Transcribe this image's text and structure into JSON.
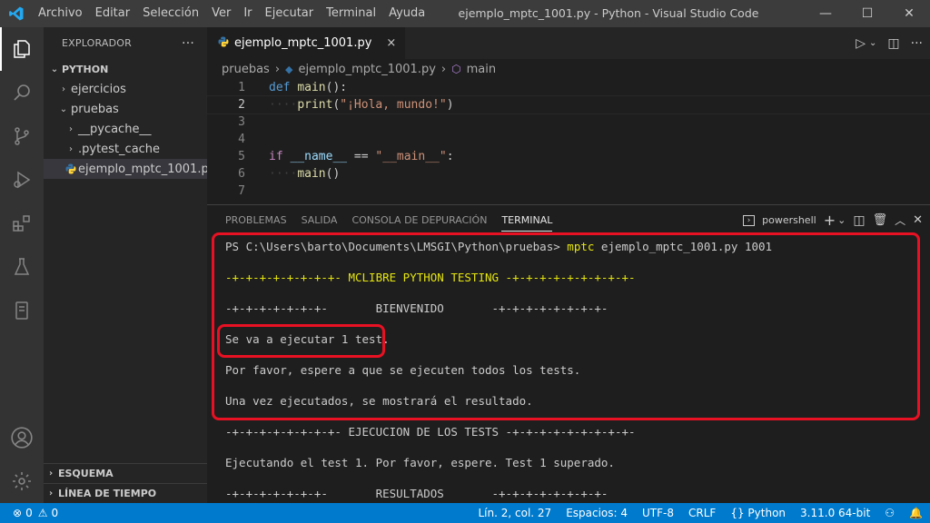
{
  "titlebar": {
    "menu": [
      "Archivo",
      "Editar",
      "Selección",
      "Ver",
      "Ir",
      "Ejecutar",
      "Terminal",
      "Ayuda"
    ],
    "window_title": "ejemplo_mptc_1001.py - Python - Visual Studio Code",
    "controls": {
      "minimize": "—",
      "maximize": "☐",
      "close": "✕"
    }
  },
  "activitybar": {
    "icons": [
      "explorer-icon",
      "search-icon",
      "source-control-icon",
      "run-debug-icon",
      "extensions-icon",
      "testing-icon",
      "remote-icon",
      "account-icon",
      "settings-gear-icon"
    ]
  },
  "sidebar": {
    "header": "EXPLORADOR",
    "more": "···",
    "root": "PYTHON",
    "items": [
      {
        "label": "ejercicios",
        "chev": "›"
      },
      {
        "label": "pruebas",
        "chev": "⌄"
      },
      {
        "label": "__pycache__",
        "chev": "›"
      },
      {
        "label": ".pytest_cache",
        "chev": "›"
      },
      {
        "label": "ejemplo_mptc_1001.py",
        "chev": ""
      }
    ],
    "outline": "ESQUEMA",
    "timeline": "LÍNEA DE TIEMPO"
  },
  "editor": {
    "tab_label": "ejemplo_mptc_1001.py",
    "tab_close": "×",
    "breadcrumb": [
      "pruebas",
      "ejemplo_mptc_1001.py",
      "main"
    ],
    "line_numbers": [
      "1",
      "2",
      "3",
      "4",
      "5",
      "6",
      "7"
    ],
    "code": {
      "l1_kw": "def",
      "l1_fn": "main",
      "l1_rest": "():",
      "l2_fn": "print",
      "l2_str": "\"¡Hola, mundo!\"",
      "l5_kw": "if",
      "l5_var": "__name__",
      "l5_op": " == ",
      "l5_str": "\"__main__\"",
      "l6_fn": "main"
    }
  },
  "panel": {
    "tabs": [
      "PROBLEMAS",
      "SALIDA",
      "CONSOLA DE DEPURACIÓN",
      "TERMINAL"
    ],
    "shell": "powershell",
    "terminal": {
      "prompt": "PS C:\\Users\\barto\\Documents\\LMSGI\\Python\\pruebas> ",
      "command": "mptc",
      "args": " ejemplo_mptc_1001.py 1001",
      "header": "-+-+-+-+-+-+-+-+- MCLIBRE PYTHON TESTING -+-+-+-+-+-+-+-+-+-",
      "welcome": "-+-+-+-+-+-+-+-       BIENVENIDO       -+-+-+-+-+-+-+-+-",
      "line1": "Se va a ejecutar 1 test.",
      "line2": "Por favor, espere a que se ejecuten todos los tests.",
      "line3": "Una vez ejecutados, se mostrará el resultado.",
      "exec_header": "-+-+-+-+-+-+-+-+- EJECUCION DE LOS TESTS -+-+-+-+-+-+-+-+-+-",
      "line4": "Ejecutando el test 1. Por favor, espere. Test 1 superado.",
      "results": "-+-+-+-+-+-+-+-       RESULTADOS       -+-+-+-+-+-+-+-+-"
    }
  },
  "statusbar": {
    "errors": "0",
    "warnings": "0",
    "position": "Lín. 2, col. 27",
    "spaces": "Espacios: 4",
    "encoding": "UTF-8",
    "eol": "CRLF",
    "language": "Python",
    "interpreter": "3.11.0 64-bit"
  },
  "colors": {
    "status_bar": "#007acc",
    "highlight_box": "#e81123"
  }
}
